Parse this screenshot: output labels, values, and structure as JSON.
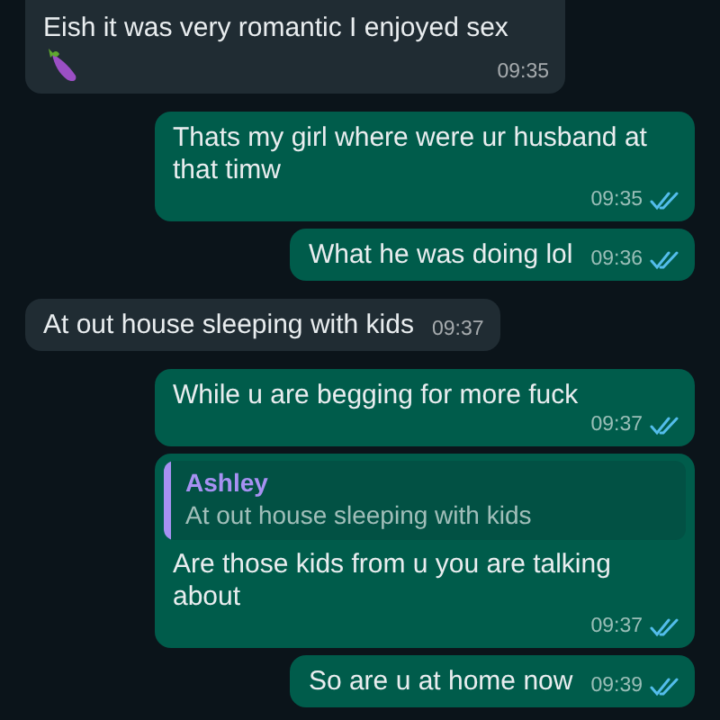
{
  "messages": [
    {
      "kind": "received",
      "text": "Eish it was very romantic I enjoyed sex",
      "eggplant_emoji": true,
      "time": "09:35"
    },
    {
      "kind": "sent",
      "text": "Thats my girl where were ur husband at that timw",
      "time": "09:35",
      "read": true
    },
    {
      "kind": "sent",
      "text": "What he was doing lol",
      "time": "09:36",
      "read": true
    },
    {
      "kind": "received",
      "text": "At out house sleeping with kids",
      "time": "09:37"
    },
    {
      "kind": "sent",
      "text": "While u are begging for more fuck",
      "time": "09:37",
      "read": true
    },
    {
      "kind": "sent",
      "quote": {
        "author": "Ashley",
        "color": "#a791f2",
        "text": "At out house sleeping with kids"
      },
      "text": "Are those kids from u you are talking about",
      "time": "09:37",
      "read": true
    },
    {
      "kind": "sent",
      "text": "So are u at home now",
      "time": "09:39",
      "read": true
    }
  ]
}
